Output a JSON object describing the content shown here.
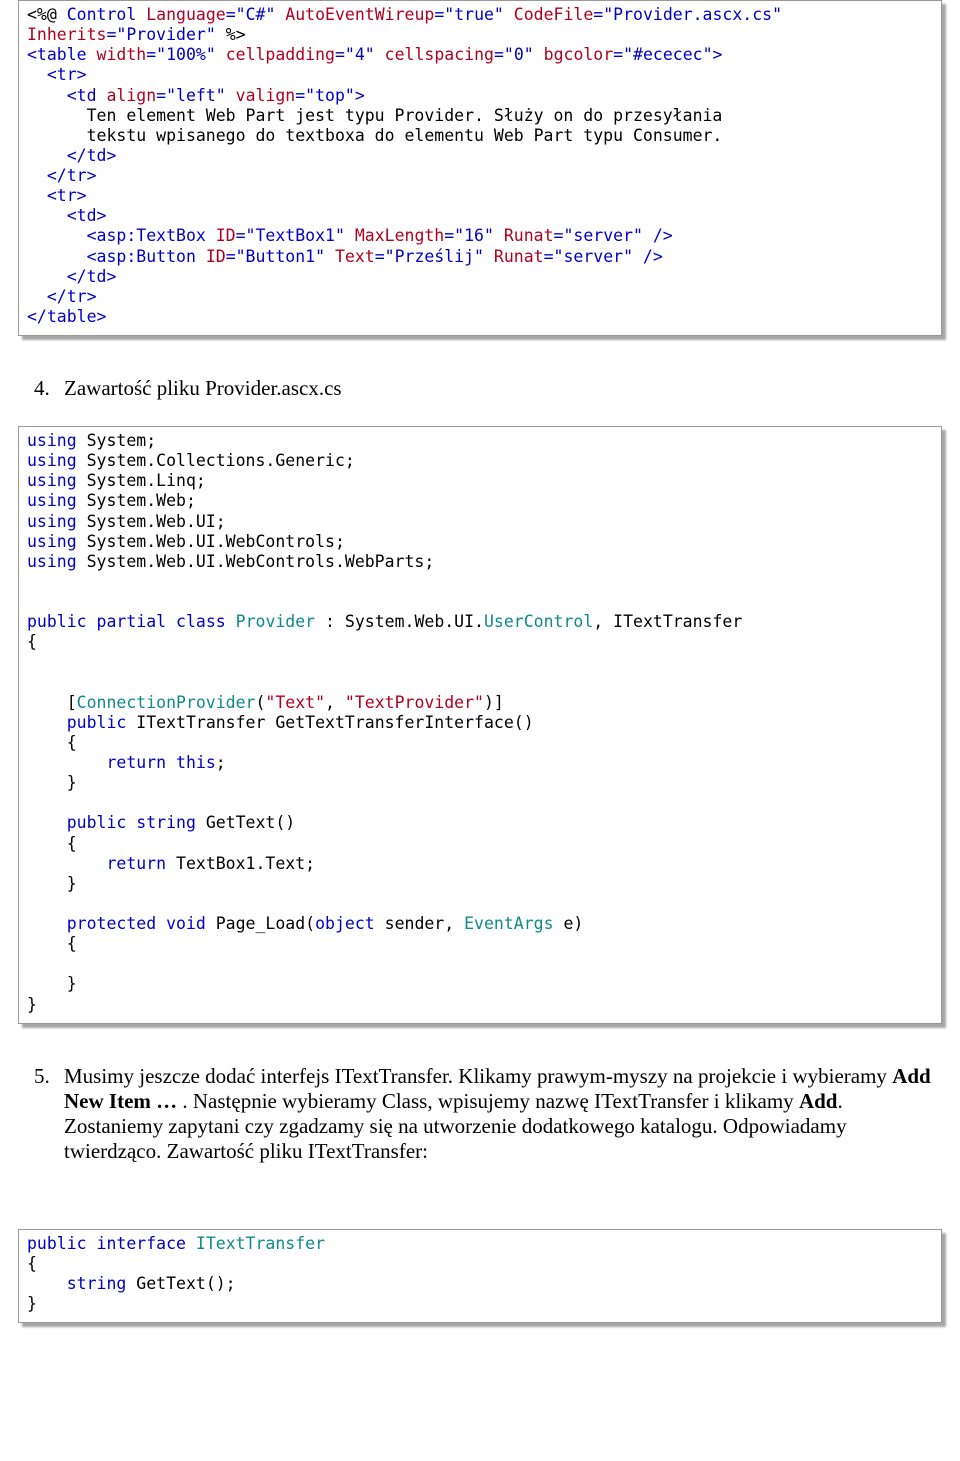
{
  "block1": {
    "l01a": "<%@",
    "l01b": " Control ",
    "l01c": "Language",
    "l01d": "=\"C#\"",
    "l01e": " AutoEventWireup",
    "l01f": "=\"true\"",
    "l01g": " CodeFile",
    "l01h": "=\"Provider.ascx.cs\"",
    "l02a": "Inherits",
    "l02b": "=\"Provider\"",
    "l02c": " %>",
    "l03a": "<table ",
    "l03b": "width",
    "l03c": "=\"100%\"",
    "l03d": " cellpadding",
    "l03e": "=\"4\"",
    "l03f": " cellspacing",
    "l03g": "=\"0\"",
    "l03h": " bgcolor",
    "l03i": "=\"#ececec\">",
    "l04": "  <tr>",
    "l05a": "    <td ",
    "l05b": "align",
    "l05c": "=\"left\"",
    "l05d": " valign",
    "l05e": "=\"top\">",
    "l06": "      Ten element Web Part jest typu Provider. Służy on do przesyłania",
    "l07": "      tekstu wpisanego do textboxa do elementu Web Part typu Consumer.",
    "l08": "    </td>",
    "l09": "  </tr>",
    "l10": "  <tr>",
    "l11": "    <td>",
    "l12a": "      <asp:TextBox ",
    "l12b": "ID",
    "l12c": "=\"TextBox1\"",
    "l12d": " MaxLength",
    "l12e": "=\"16\"",
    "l12f": " Runat",
    "l12g": "=\"server\" />",
    "l13a": "      <asp:Button ",
    "l13b": "ID",
    "l13c": "=\"Button1\"",
    "l13d": " Text",
    "l13e": "=\"Prześlij\"",
    "l13f": " Runat",
    "l13g": "=\"server\" />",
    "l14": "    </td>",
    "l15": "  </tr>",
    "l16": "</table>"
  },
  "list4": {
    "num": "4.",
    "text": "Zawartość pliku Provider.ascx.cs"
  },
  "block2": {
    "u1a": "using",
    "u1b": " System;",
    "u2a": "using",
    "u2b": " System.Collections.Generic;",
    "u3a": "using",
    "u3b": " System.Linq;",
    "u4a": "using",
    "u4b": " System.Web;",
    "u5a": "using",
    "u5b": " System.Web.UI;",
    "u6a": "using",
    "u6b": " System.Web.UI.WebControls;",
    "u7a": "using",
    "u7b": " System.Web.UI.WebControls.WebParts;",
    "blank1": "",
    "blank2": "",
    "c1a": "public",
    "c1b": " partial",
    "c1c": " class",
    "c1d": " Provider",
    "c1e": " : System.Web.UI.",
    "c1f": "UserControl",
    "c1g": ", ITextTransfer",
    "c2": "{",
    "blank3": "",
    "blank4": "",
    "a1a": "    [",
    "a1b": "ConnectionProvider",
    "a1c": "(",
    "a1d": "\"Text\"",
    "a1e": ", ",
    "a1f": "\"TextProvider\"",
    "a1g": ")]",
    "m1a": "    public",
    "m1b": " ITextTransfer GetTextTransferInterface()",
    "m1c": "    {",
    "m1d": "        return",
    "m1e": " this",
    "m1f": ";",
    "m1g": "    }",
    "blank5": "",
    "m2a": "    public",
    "m2b": " string",
    "m2c": " GetText()",
    "m2d": "    {",
    "m2e": "        return",
    "m2f": " TextBox1.Text;",
    "m2g": "    }",
    "blank6": "",
    "m3a": "    protected",
    "m3b": " void",
    "m3c": " Page_Load(",
    "m3d": "object",
    "m3e": " sender, ",
    "m3f": "EventArgs",
    "m3g": " e)",
    "m3h": "    {",
    "blank7": "",
    "m3i": "    }",
    "c3": "}"
  },
  "list5": {
    "num": "5.",
    "p1": "Musimy jeszcze dodać interfejs ITextTransfer. Klikamy prawym-myszy na projekcie i wybieramy ",
    "b1": "Add New Item …",
    "p2": " . Następnie wybieramy Class, wpisujemy nazwę ITextTransfer i klikamy ",
    "b2": "Add",
    "p3": ". Zostaniemy zapytani czy zgadzamy się na utworzenie dodatkowego katalogu. Odpowiadamy twierdząco. Zawartość pliku ITextTransfer:"
  },
  "block3": {
    "l1a": "public",
    "l1b": " interface",
    "l1c": " ITextTransfer",
    "l2": "{",
    "l3a": "    string",
    "l3b": " GetText();",
    "l4": "}"
  }
}
